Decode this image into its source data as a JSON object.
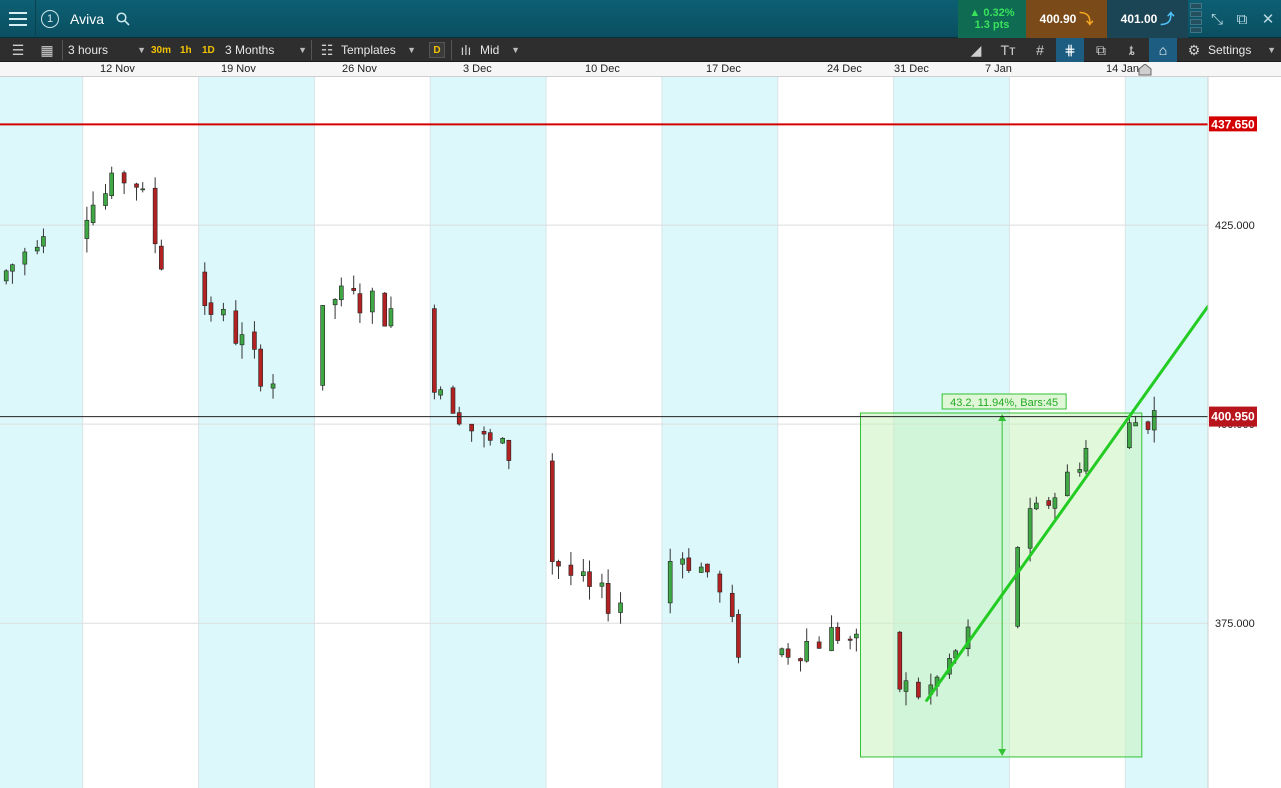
{
  "header": {
    "market_name": "Aviva",
    "layout_number": "1",
    "change_pct": "▲ 0.32%",
    "change_pts": "1.3 pts",
    "sell_price": "400.90",
    "buy_price": "401.00",
    "colors": {
      "header_bg": "#0b5566",
      "sell_bg": "#7a4a18",
      "buy_bg": "#1b4455",
      "positive": "#38e25c"
    }
  },
  "toolbar": {
    "interval": "3 hours",
    "quick_intervals": [
      "30m",
      "1h",
      "1D"
    ],
    "range": "3 Months",
    "templates": "Templates",
    "template_badge": "D",
    "price_mode": "Mid",
    "settings": "Settings",
    "icons": [
      "list-icon",
      "chart-layout-icon",
      "draw-line-icon",
      "text-icon",
      "crosshair-icon",
      "magnet-icon",
      "duplicate-icon",
      "candle-type-icon",
      "tag-icon",
      "gear-icon"
    ]
  },
  "date_axis": [
    "12 Nov",
    "19 Nov",
    "26 Nov",
    "3 Dec",
    "10 Dec",
    "17 Dec",
    "24 Dec",
    "31 Dec",
    "7 Jan",
    "14 Jan"
  ],
  "price_axis": {
    "ticks": [
      "425.000",
      "375.000"
    ],
    "hidden_tick": "400.000",
    "current_price": "400.950",
    "alert_price": "437.650"
  },
  "measure_tool": {
    "label": "43.2, 11.94%, Bars:45"
  },
  "chart_data": {
    "type": "candlestick",
    "title": "",
    "ylim": [
      354.3,
      443.6
    ],
    "x_start": "2018-11-07",
    "x_end": "2019-01-19",
    "alert_level": 437.65,
    "current_level": 400.95,
    "colors": {
      "up": "#3fa845",
      "down": "#b22222",
      "alert": "#d40000",
      "trend": "#22cc22",
      "shade": "#dcf8fb"
    },
    "trendline": {
      "from": {
        "date": "2019-01-02",
        "price": 365.3
      },
      "to": {
        "date": "2019-01-19",
        "price": 414.8
      }
    },
    "measure": {
      "from_date": "2018-12-29",
      "to_date": "2019-01-15",
      "low": 358.2,
      "high": 401.4,
      "change": 43.2,
      "change_pct": 11.94,
      "bars": 45
    }
  }
}
